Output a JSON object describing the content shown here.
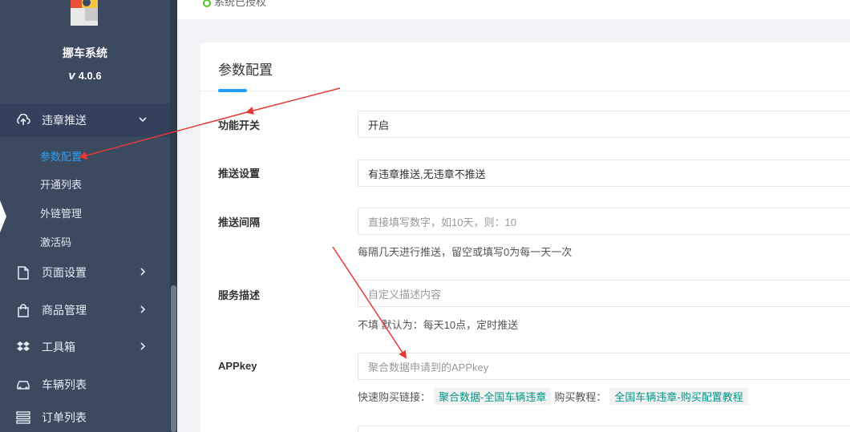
{
  "app": {
    "name": "挪车系统",
    "version": "4.0.6"
  },
  "sidebar": {
    "menus": [
      {
        "label": "违章推送",
        "icon": "cloud-upload-icon",
        "expanded": true
      },
      {
        "label": "页面设置",
        "icon": "document-icon"
      },
      {
        "label": "商品管理",
        "icon": "bag-icon"
      },
      {
        "label": "工具箱",
        "icon": "dropbox-icon"
      },
      {
        "label": "车辆列表",
        "icon": "car-icon"
      },
      {
        "label": "订单列表",
        "icon": "list-icon"
      }
    ],
    "submenu": [
      {
        "label": "参数配置",
        "active": true
      },
      {
        "label": "开通列表"
      },
      {
        "label": "外链管理"
      },
      {
        "label": "激活码"
      }
    ]
  },
  "topbar": {
    "status": "系统已授权"
  },
  "form": {
    "title": "参数配置",
    "fields": [
      {
        "label": "功能开关",
        "value": "开启",
        "placeholder": ""
      },
      {
        "label": "推送设置",
        "value": "有违章推送,无违章不推送",
        "placeholder": ""
      },
      {
        "label": "推送间隔",
        "value": "",
        "placeholder": "直接填写数字，如10天，则：10",
        "help": "每隔几天进行推送，留空或填写0为每一天一次"
      },
      {
        "label": "服务描述",
        "value": "",
        "placeholder": "自定义描述内容",
        "help": "不填 默认为：每天10点，定时推送"
      },
      {
        "label": "APPkey",
        "value": "",
        "placeholder": "聚合数据申请到的APPkey"
      }
    ],
    "appkey_help": {
      "buy_prefix": "快速购买链接：",
      "buy_link": "聚合数据-全国车辆违章",
      "tutorial_prefix": "购买教程：",
      "tutorial_link": "全国车辆违章-购买配置教程"
    }
  },
  "colors": {
    "sidebar_bg": "#3c4a60",
    "accent": "#1e9fff",
    "active_text": "#2aa0f0",
    "annotation_arrow": "#e53935",
    "link_tag": "#009688"
  }
}
